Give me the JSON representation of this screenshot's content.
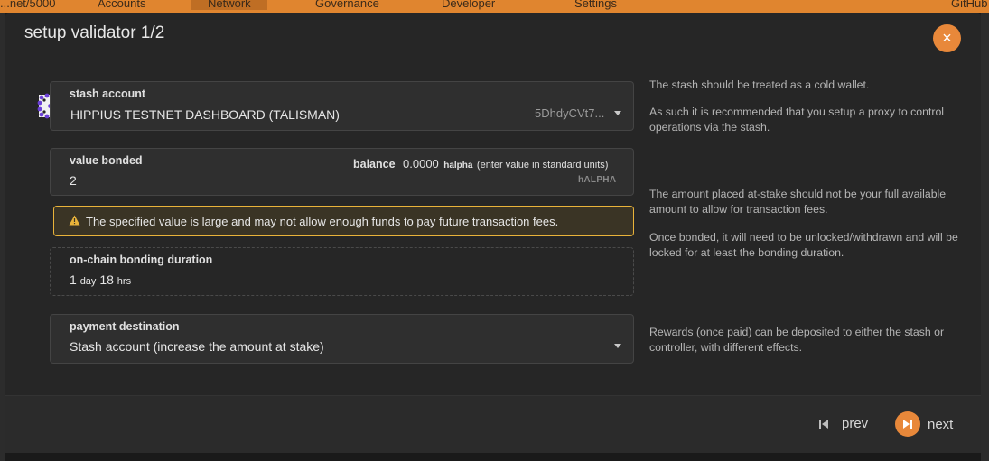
{
  "nav": {
    "chain": "...net/5000",
    "accounts": "Accounts",
    "network": "Network",
    "governance": "Governance",
    "developer": "Developer",
    "settings": "Settings",
    "github": "GitHub"
  },
  "modal": {
    "title": "setup validator 1/2",
    "close_icon": "×"
  },
  "stash": {
    "label": "stash account",
    "account_name": "HIPPIUS TESTNET DASHBOARD (TALISMAN)",
    "address": "5DhdyCVt7..."
  },
  "bond": {
    "label": "value bonded",
    "balance_label": "balance",
    "balance_value": "0.0000",
    "balance_unit": "halpha",
    "hint": "(enter value in standard units)",
    "value": "2",
    "unit": "hALPHA"
  },
  "warning": {
    "text": "The specified value is large and may not allow enough funds to pay future transaction fees."
  },
  "duration": {
    "label": "on-chain bonding duration",
    "days": "1",
    "days_unit": "day",
    "hours": "18",
    "hours_unit": "hrs"
  },
  "payment": {
    "label": "payment destination",
    "value": "Stash account (increase the amount at stake)"
  },
  "help": {
    "stash_1": "The stash should be treated as a cold wallet.",
    "stash_2": "As such it is recommended that you setup a proxy to control operations via the stash.",
    "bond_1": "The amount placed at-stake should not be your full available amount to allow for transaction fees.",
    "bond_2": "Once bonded, it will need to be unlocked/withdrawn and will be locked for at least the bonding duration.",
    "payment": "Rewards (once paid) can be deposited to either the stash or controller, with different effects."
  },
  "footer": {
    "prev": "prev",
    "next": "next"
  },
  "colors": {
    "accent": "#e8883a",
    "warning_border": "#e9b33a",
    "modal_bg": "#262626"
  }
}
